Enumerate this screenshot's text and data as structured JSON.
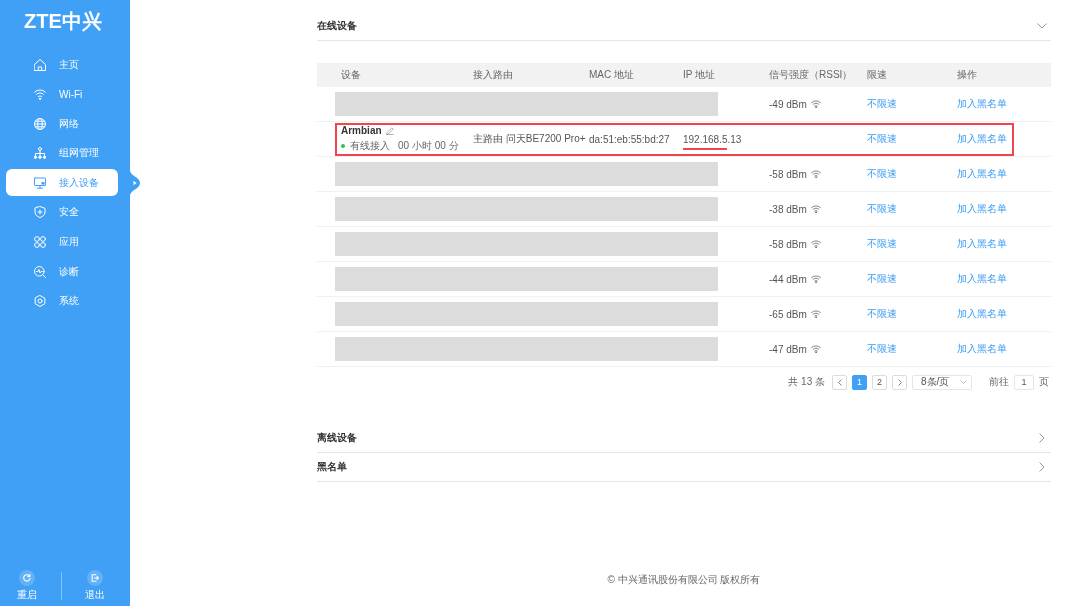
{
  "sidebar": {
    "logo": "ZTE中兴",
    "items": [
      {
        "label": "主页",
        "selected": false
      },
      {
        "label": "Wi-Fi",
        "selected": false
      },
      {
        "label": "网络",
        "selected": false
      },
      {
        "label": "组网管理",
        "selected": false
      },
      {
        "label": "接入设备",
        "selected": true
      },
      {
        "label": "安全",
        "selected": false
      },
      {
        "label": "应用",
        "selected": false
      },
      {
        "label": "诊断",
        "selected": false
      },
      {
        "label": "系统",
        "selected": false
      }
    ],
    "actions": [
      {
        "label": "重启"
      },
      {
        "label": "退出"
      }
    ]
  },
  "panels": [
    {
      "title": "在线设备",
      "expanded": true,
      "table": {
        "columns": [
          "设备",
          "接入路由",
          "MAC 地址",
          "IP 地址",
          "信号强度（RSSI）",
          "限速",
          "操作"
        ],
        "rows": [
          {
            "redacted": true,
            "highlighted": false,
            "rssi": "-49 dBm",
            "speed_limit": "不限速",
            "action": "加入黑名单"
          },
          {
            "redacted": false,
            "highlighted": true,
            "name": "Armbian",
            "online": true,
            "connection": "有线接入",
            "duration": "00 小时 00 分",
            "route": "主路由 问天BE7200 Pro+",
            "mac": "da:51:eb:55:bd:27",
            "ip": "192.168.5.13",
            "speed_limit": "不限速",
            "action": "加入黑名单"
          },
          {
            "redacted": true,
            "highlighted": false,
            "rssi": "-58 dBm",
            "speed_limit": "不限速",
            "action": "加入黑名单"
          },
          {
            "redacted": true,
            "highlighted": false,
            "rssi": "-38 dBm",
            "speed_limit": "不限速",
            "action": "加入黑名单"
          },
          {
            "redacted": true,
            "highlighted": false,
            "rssi": "-58 dBm",
            "speed_limit": "不限速",
            "action": "加入黑名单"
          },
          {
            "redacted": true,
            "highlighted": false,
            "rssi": "-44 dBm",
            "speed_limit": "不限速",
            "action": "加入黑名单"
          },
          {
            "redacted": true,
            "highlighted": false,
            "rssi": "-65 dBm",
            "speed_limit": "不限速",
            "action": "加入黑名单"
          },
          {
            "redacted": true,
            "highlighted": false,
            "rssi": "-47 dBm",
            "speed_limit": "不限速",
            "action": "加入黑名单"
          }
        ]
      },
      "pagination": {
        "total": "共 13 条",
        "pages": [
          {
            "label": "1",
            "selected": true
          },
          {
            "label": "2",
            "selected": false
          }
        ],
        "page_size": "8条/页",
        "goto_label": "前往",
        "goto_value": "1",
        "goto_unit": "页"
      }
    },
    {
      "title": "离线设备",
      "expanded": false
    },
    {
      "title": "黑名单",
      "expanded": false
    }
  ],
  "footer": "© 中兴通讯股份有限公司 版权所有"
}
